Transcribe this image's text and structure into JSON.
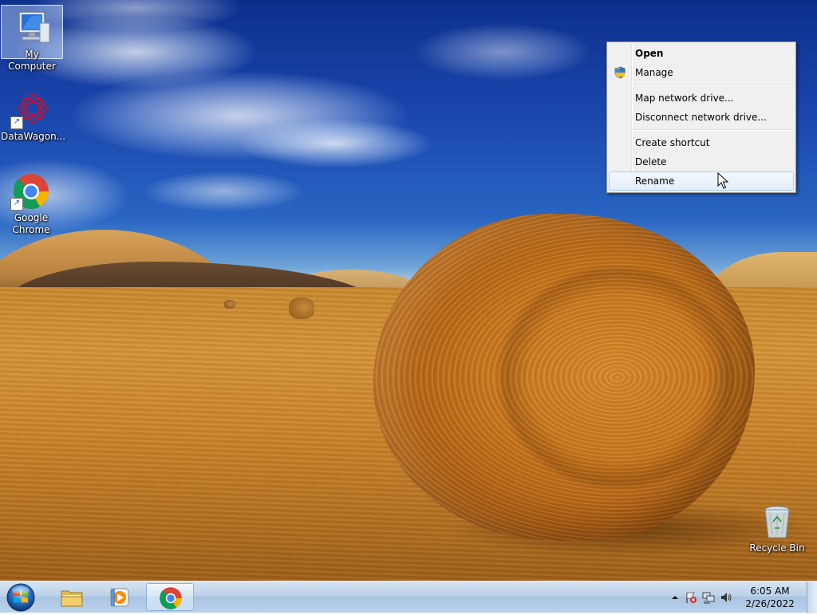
{
  "desktop": {
    "icons": [
      {
        "label": "My Computer"
      },
      {
        "label": "DataWagon..."
      },
      {
        "label": "Google Chrome"
      },
      {
        "label": "Recycle Bin"
      }
    ]
  },
  "context_menu": {
    "items": [
      {
        "label": "Open"
      },
      {
        "label": "Manage"
      },
      {
        "label": "Map network drive..."
      },
      {
        "label": "Disconnect network drive..."
      },
      {
        "label": "Create shortcut"
      },
      {
        "label": "Delete"
      },
      {
        "label": "Rename"
      }
    ]
  },
  "taskbar": {
    "time": "6:05 AM",
    "date": "2/26/2022"
  },
  "icons": {
    "start": "windows-orb-icon",
    "explorer": "folder-icon",
    "media": "media-player-icon",
    "chrome": "chrome-icon"
  }
}
